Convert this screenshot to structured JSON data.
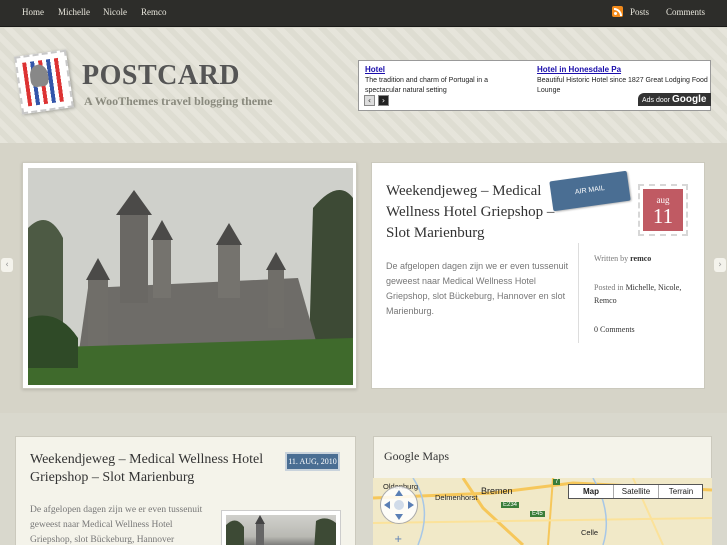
{
  "nav": {
    "left": [
      "Home",
      "Michelle",
      "Nicole",
      "Remco"
    ],
    "right": [
      "Posts",
      "Comments"
    ]
  },
  "logo": {
    "title": "POSTCARD",
    "tagline": "A WooThemes travel blogging theme",
    "stamp_text": "postcard"
  },
  "ad": {
    "items": [
      {
        "title": "Hotel",
        "desc": "The tradition and charm of Portugal in a spectacular natural setting"
      },
      {
        "title": "Hotel in Honesdale Pa",
        "desc": "Beautiful Historic Hotel since 1827 Great Lodging Food Lounge"
      }
    ],
    "prev": "‹",
    "next": "›",
    "by_label": "Ads door",
    "by_brand": "Google"
  },
  "featured": {
    "title": "Weekendjeweg – Medical Wellness Hotel Griepshop – Slot Marienburg",
    "excerpt": "De afgelopen dagen zijn we er even tussenuit geweest naar Medical Wellness Hotel Griepshop, slot Bückeburg, Hannover en slot Marienburg.",
    "airmail": "AIR MAIL",
    "date_month": "aug",
    "date_day": "11",
    "written_by_label": "Written by",
    "author": "remco",
    "posted_in_label": "Posted in",
    "categories": "Michelle, Nicole, Remco",
    "comments": "0 Comments",
    "arrow_left": "‹",
    "arrow_right": "›"
  },
  "post2": {
    "title": "Weekendjeweg – Medical Wellness Hotel Griepshop – Slot Marienburg",
    "date": "11. AUG, 2010",
    "excerpt": "De afgelopen dagen zijn we er even tussenuit geweest naar Medical Wellness Hotel Griepshop, slot Bückeburg, Hannover"
  },
  "maps": {
    "title": "Google Maps",
    "buttons": [
      "Map",
      "Satellite",
      "Terrain"
    ],
    "cities": [
      "Oldenburg",
      "Delmenhorst",
      "Bremen",
      "Celle"
    ],
    "roads": [
      "7",
      "E234",
      "E45"
    ]
  },
  "colors": {
    "nav_bg": "#2d2d2a",
    "accent_blue": "#4a6e93",
    "date_red": "#c05a63"
  }
}
